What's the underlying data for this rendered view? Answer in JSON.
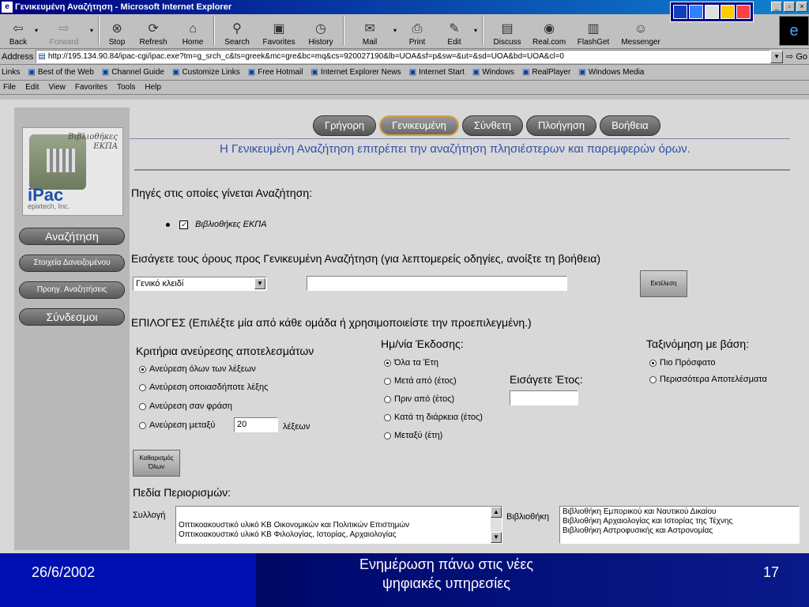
{
  "window": {
    "title": "Γενικευμένη Αναζήτηση - Microsoft Internet Explorer"
  },
  "toolbar": {
    "buttons": [
      {
        "label": "Back",
        "icon": "back-arrow-icon",
        "glyph": "⇦"
      },
      {
        "label": "Forward",
        "icon": "forward-arrow-icon",
        "glyph": "⇨"
      },
      {
        "label": "Stop",
        "icon": "stop-icon",
        "glyph": "⊗"
      },
      {
        "label": "Refresh",
        "icon": "refresh-icon",
        "glyph": "⟳"
      },
      {
        "label": "Home",
        "icon": "home-icon",
        "glyph": "⌂"
      },
      {
        "label": "Search",
        "icon": "search-icon",
        "glyph": "⚲"
      },
      {
        "label": "Favorites",
        "icon": "favorites-icon",
        "glyph": "▣"
      },
      {
        "label": "History",
        "icon": "history-icon",
        "glyph": "◷"
      },
      {
        "label": "Mail",
        "icon": "mail-icon",
        "glyph": "✉"
      },
      {
        "label": "Print",
        "icon": "print-icon",
        "glyph": "⎙"
      },
      {
        "label": "Edit",
        "icon": "edit-icon",
        "glyph": "✎"
      },
      {
        "label": "Discuss",
        "icon": "discuss-icon",
        "glyph": "▤"
      },
      {
        "label": "Real.com",
        "icon": "real-icon",
        "glyph": "◉"
      },
      {
        "label": "FlashGet",
        "icon": "flashget-icon",
        "glyph": "▥"
      },
      {
        "label": "Messenger",
        "icon": "messenger-icon",
        "glyph": "☺"
      }
    ]
  },
  "address": {
    "label": "Address",
    "url": "http://195.134.90.84/ipac-cgi/ipac.exe?tm=g_srch_c&ts=greek&mc=gre&bc=mq&cs=920027190&lb=UOA&sf=p&sw=&ut=&sd=UOA&bd=UOA&cl=0",
    "go": "Go"
  },
  "links": {
    "label": "Links",
    "items": [
      "Best of the Web",
      "Channel Guide",
      "Customize Links",
      "Free Hotmail",
      "Internet Explorer News",
      "Internet Start",
      "Windows",
      "RealPlayer",
      "Windows Media"
    ]
  },
  "menu": {
    "items": [
      "File",
      "Edit",
      "View",
      "Favorites",
      "Tools",
      "Help"
    ]
  },
  "sidebar": {
    "logo_top": "Βιβλιοθήκες ΕΚΠΑ",
    "logo_ipac": "iPac",
    "logo_sub": "epixtech, Inc.",
    "buttons": [
      "Αναζήτηση",
      "Στοιχεία Δανειζομένου",
      "Προηγ. Αναζητήσεις",
      "Σύνδεσμοι"
    ]
  },
  "tabs": [
    "Γρήγορη",
    "Γενικευμένη",
    "Σύνθετη",
    "Πλοήγηση",
    "Βοήθεια"
  ],
  "info_text": "Η Γενικευμένη Αναζήτηση επιτρέπει την αναζήτηση πλησιέστερων και παρεμφερών όρων.",
  "sources": {
    "heading": "Πηγές στις οποίες γίνεται Αναζήτηση:",
    "item": "Βιβλιοθήκες ΕΚΠΑ"
  },
  "terms": {
    "heading": "Εισάγετε τους όρους προς Γενικευμένη Αναζήτηση (για λεπτομερείς οδηγίες, ανοίξτε τη βοήθεια)",
    "select_value": "Γενικό κλειδί",
    "input_value": "",
    "execute_label": "Εκτέλεση"
  },
  "options": {
    "heading": "ΕΠΙΛΟΓΕΣ (Επιλέξτε μία από κάθε ομάδα ή χρησιμοποιείστε την προεπιλεγμένη.)",
    "criteria": {
      "title": "Κριτήρια ανεύρεσης αποτελεσμάτων",
      "items": [
        "Ανεύρεση όλων των λέξεων",
        "Ανεύρεση οποιασδήποτε λέξης",
        "Ανεύρεση σαν φράση",
        "Ανεύρεση μεταξύ"
      ],
      "between_value": "20",
      "between_suffix": "λέξεων"
    },
    "date": {
      "title": "Ημ/νία Έκδοσης:",
      "items": [
        "Όλα τα Έτη",
        "Μετά από (έτος)",
        "Πριν από (έτος)",
        "Κατά τη διάρκεια (έτος)",
        "Μεταξύ (έτη)"
      ],
      "year_label": "Εισάγετε Έτος:",
      "year_value": ""
    },
    "sort": {
      "title": "Ταξινόμηση με βάση:",
      "items": [
        "Πιο Πρόσφατο",
        "Περισσότερα Αποτελέσματα"
      ]
    },
    "clear_line1": "Καθαρισμός",
    "clear_line2": "Όλων"
  },
  "limits": {
    "heading": "Πεδία Περιορισμών:",
    "collection_label": "Συλλογή",
    "collection_items": [
      "Οπτικοακουστικό υλικό ΚΒ Οικονομικών και Πολιτικών Επιστημών",
      "Οπτικοακουστικό υλικό ΚΒ Φιλολογίας, Ιστορίας, Αρχαιολογίας"
    ],
    "library_label": "Βιβλιοθήκη",
    "library_items": [
      "Βιβλιοθήκη Εμπορικού και Ναυτικού Δικαίου",
      "Βιβλιοθήκη Αρχαιολογίας και Ιστορίας της Τέχνης",
      "Βιβλιοθήκη Αστροφυσικής και Αστρονομίας"
    ]
  },
  "slide": {
    "date": "26/6/2002",
    "caption_line1": "Ενημέρωση πάνω στις νέες",
    "caption_line2": "ψηφιακές υπηρεσίες",
    "number": "17"
  }
}
